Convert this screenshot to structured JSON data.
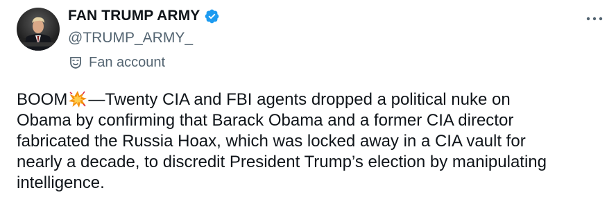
{
  "account": {
    "display_name": "FAN TRUMP ARMY",
    "handle": "@TRUMP_ARMY_",
    "label": "Fan account",
    "verified": true,
    "verified_color": "#1d9bf0"
  },
  "menu": {
    "more_icon": "more-horizontal-icon"
  },
  "tweet": {
    "prefix": "BOOM",
    "emoji": "collision-emoji",
    "line1_rest": "—Twenty CIA and FBI agents dropped a political nuke on",
    "line2": "Obama by confirming that Barack Obama and a former CIA director",
    "line3": "fabricated the Russia Hoax, which was locked away in a CIA vault for",
    "line4": "nearly a decade, to discredit President Trump’s election by manipulating",
    "line5": "intelligence."
  },
  "colors": {
    "text": "#0f1419",
    "secondary": "#536471"
  }
}
